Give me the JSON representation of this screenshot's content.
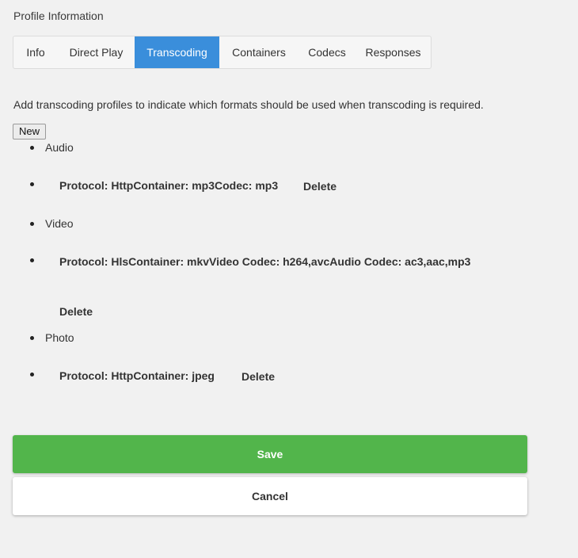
{
  "section": {
    "title": "Profile Information"
  },
  "tabs": [
    {
      "label": "Info",
      "active": false
    },
    {
      "label": "Direct Play",
      "active": false
    },
    {
      "label": "Transcoding",
      "active": true
    },
    {
      "label": "Containers",
      "active": false
    },
    {
      "label": "Codecs",
      "active": false
    },
    {
      "label": "Responses",
      "active": false
    }
  ],
  "description": "Add transcoding profiles to indicate which formats should be used when transcoding is required.",
  "new_label": "New",
  "categories": [
    {
      "label": "Audio",
      "profiles": [
        {
          "text": "Protocol: HttpContainer: mp3Codec: mp3",
          "delete_label": "Delete"
        }
      ]
    },
    {
      "label": "Video",
      "profiles": [
        {
          "text": "Protocol: HlsContainer: mkvVideo Codec: h264,avcAudio Codec: ac3,aac,mp3",
          "delete_label": "Delete"
        }
      ]
    },
    {
      "label": "Photo",
      "profiles": [
        {
          "text": "Protocol: HttpContainer: jpeg",
          "delete_label": "Delete"
        }
      ]
    }
  ],
  "actions": {
    "save_label": "Save",
    "cancel_label": "Cancel"
  },
  "colors": {
    "accent": "#3a8edb",
    "save": "#52b54b",
    "background": "#f1f1f1"
  }
}
